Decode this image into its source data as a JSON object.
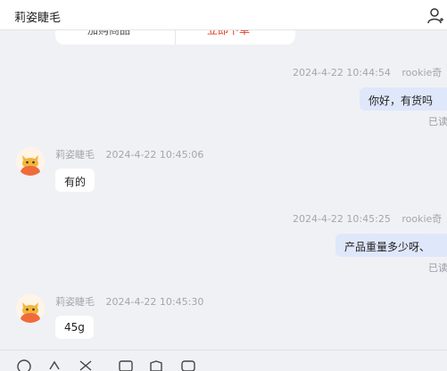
{
  "header": {
    "title": "莉姿睫毛"
  },
  "top_card": {
    "left_text": "加购商品",
    "right_text": "立即下单"
  },
  "messages": [
    {
      "direction": "out",
      "sender": "rookie奇",
      "time": "2024-4-22 10:44:54",
      "text": "你好，有货吗",
      "status": "已读"
    },
    {
      "direction": "in",
      "sender": "莉姿睫毛",
      "time": "2024-4-22 10:45:06",
      "text": "有的"
    },
    {
      "direction": "out",
      "sender": "rookie奇",
      "time": "2024-4-22 10:45:25",
      "text": "产品重量多少呀、",
      "status": "已读"
    },
    {
      "direction": "in",
      "sender": "莉姿睫毛",
      "time": "2024-4-22 10:45:30",
      "text": "45g"
    }
  ],
  "toolbar": {
    "icons": [
      "emoji-icon",
      "shortcut-icon",
      "scissors-icon",
      "image-icon",
      "product-icon",
      "chat-icon"
    ]
  },
  "colors": {
    "background": "#f0f1f5",
    "outgoing_bubble": "#dfe7fb",
    "incoming_bubble": "#ffffff",
    "accent_red": "#e33a1c"
  }
}
